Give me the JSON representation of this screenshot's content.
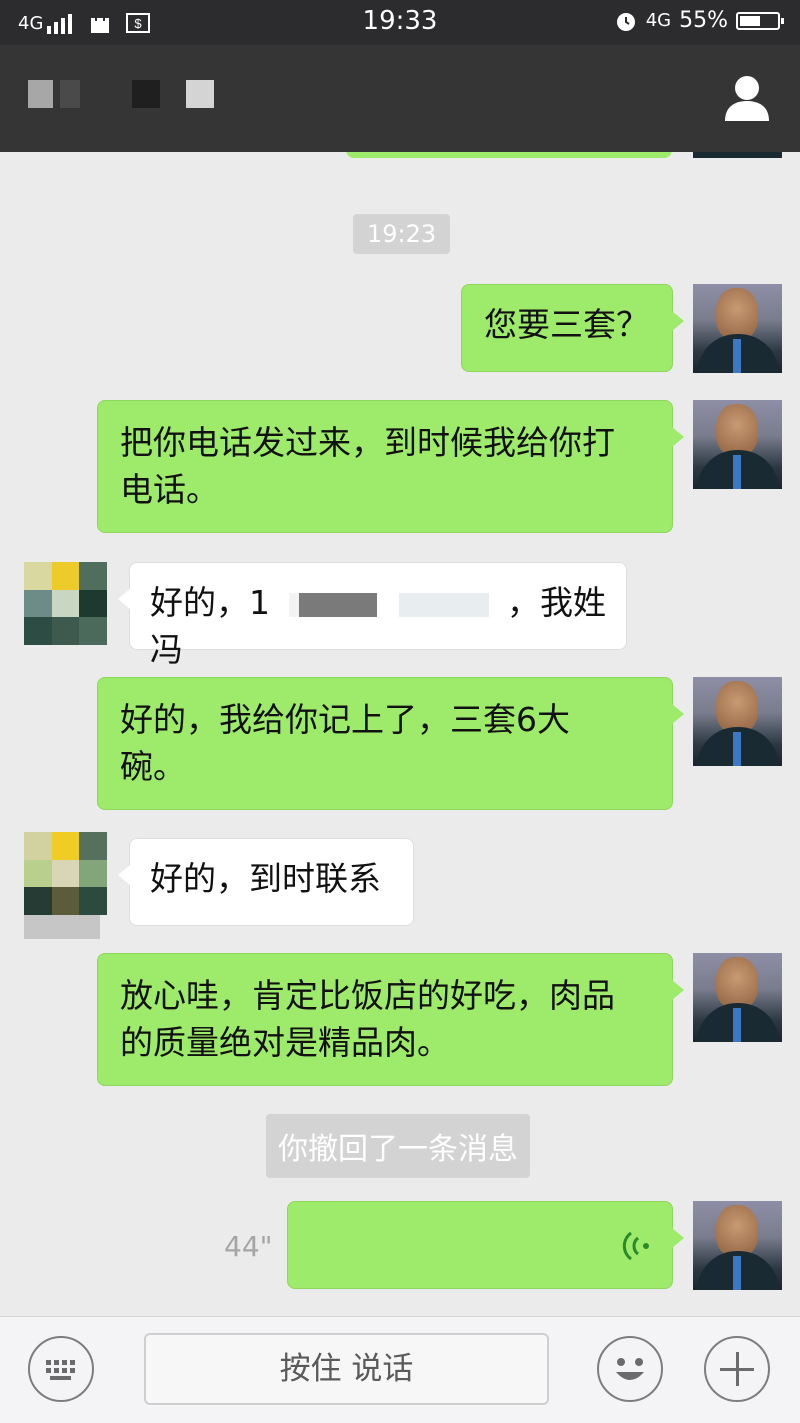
{
  "status_bar": {
    "network_left": "4G",
    "time": "19:33",
    "network_right": "4G",
    "battery": "55%",
    "battery_level": 0.55
  },
  "icons": {
    "signal": "signal-bars-icon",
    "shopping": "shopping-bag-icon",
    "payment": "payment-icon",
    "alarm": "alarm-icon",
    "contact": "person-icon",
    "voice_wave": "voice-wave-icon",
    "keyboard": "keyboard-icon",
    "emoji": "emoji-icon",
    "more": "plus-icon"
  },
  "chat": {
    "timestamp": "19:23",
    "messages": [
      {
        "sender": "me",
        "text": "您要三套？"
      },
      {
        "sender": "me",
        "line1": "把你电话发过来，到时候我给你打",
        "line2": "电话。"
      },
      {
        "sender": "other",
        "prefix": "好的，1",
        "suffix": "，我姓冯"
      },
      {
        "sender": "me",
        "line1": "好的，我给你记上了，三套6大",
        "line2": "碗。"
      },
      {
        "sender": "other",
        "text": "好的，到时联系"
      },
      {
        "sender": "me",
        "line1": "放心哇，肯定比饭店的好吃，肉品",
        "line2": "的质量绝对是精品肉。"
      }
    ],
    "recall_notice": "你撤回了一条消息",
    "voice_message": {
      "duration": "44\""
    }
  },
  "input_bar": {
    "press_to_talk": "按住 说话"
  },
  "colors": {
    "my_bubble": "#9eea6a",
    "other_bubble": "#ffffff",
    "header": "#353535",
    "chat_bg": "#ebebeb"
  }
}
